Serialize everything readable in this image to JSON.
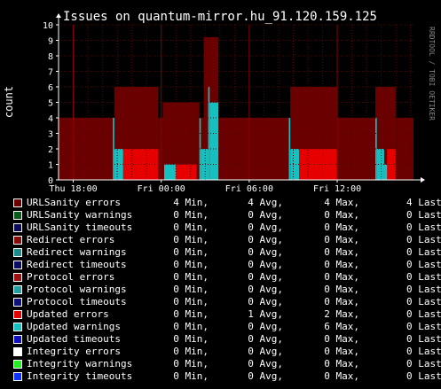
{
  "chart_data": {
    "type": "area",
    "title": "Issues on quantum-mirror.hu_91.120.159.125",
    "ylabel": "count",
    "watermark": "RRDTOOL / TOBI OETIKER",
    "ylim": [
      0,
      10
    ],
    "yticks": [
      0,
      1,
      2,
      3,
      4,
      5,
      6,
      7,
      8,
      9,
      10
    ],
    "xticks": [
      "Thu 18:00",
      "Fri 00:00",
      "Fri 06:00",
      "Fri 12:00"
    ],
    "xlim_hours": [
      0,
      24.2
    ],
    "xtick_hours": [
      1,
      7,
      13,
      19
    ],
    "colors": {
      "urlsanity_errors": "#6b0000",
      "urlsanity_errors_bright": "#7a0606",
      "updated_errors": "#e60000",
      "updated_warnings": "#15c0c0",
      "grid": "#5a0000"
    },
    "series": [
      {
        "name": "URLSanity errors",
        "color": "#6b0000",
        "segments": [
          [
            0,
            3.6,
            4
          ],
          [
            3.6,
            3.8,
            4
          ],
          [
            3.8,
            6.8,
            6
          ],
          [
            6.8,
            7.1,
            4
          ],
          [
            7.1,
            9.6,
            5
          ],
          [
            9.6,
            9.9,
            4
          ],
          [
            9.9,
            10.9,
            9.2
          ],
          [
            10.9,
            15.6,
            4
          ],
          [
            15.6,
            15.8,
            4
          ],
          [
            15.8,
            19.0,
            6
          ],
          [
            19.0,
            21.6,
            4
          ],
          [
            21.6,
            23.0,
            6
          ],
          [
            23.0,
            24.2,
            4
          ]
        ]
      },
      {
        "name": "Updated errors",
        "color": "#e60000",
        "segments": [
          [
            4.4,
            6.8,
            2
          ],
          [
            8.0,
            9.4,
            1
          ],
          [
            16.4,
            19.0,
            2
          ],
          [
            22.4,
            23.0,
            2
          ]
        ]
      },
      {
        "name": "Updated warnings",
        "color": "#15c0c0",
        "segments": [
          [
            3.7,
            3.8,
            4
          ],
          [
            3.8,
            4.4,
            2
          ],
          [
            7.2,
            8.0,
            1
          ],
          [
            9.6,
            9.7,
            4
          ],
          [
            9.7,
            10.2,
            2
          ],
          [
            10.2,
            10.3,
            6
          ],
          [
            10.3,
            10.9,
            5
          ],
          [
            15.7,
            15.8,
            4
          ],
          [
            15.8,
            16.4,
            2
          ],
          [
            21.6,
            21.7,
            4
          ],
          [
            21.7,
            22.2,
            2
          ],
          [
            22.2,
            22.4,
            1
          ]
        ]
      }
    ],
    "legend": [
      {
        "name": "URLSanity errors",
        "color": "#6b0000",
        "min": "4",
        "avg": "4",
        "max": "4",
        "last": "Last"
      },
      {
        "name": "URLSanity warnings",
        "color": "#0b5a1a",
        "min": "0",
        "avg": "0",
        "max": "0",
        "last": "Last"
      },
      {
        "name": "URLSanity timeouts",
        "color": "#0b0b5a",
        "min": "0",
        "avg": "0",
        "max": "0",
        "last": "Last"
      },
      {
        "name": "Redirect errors",
        "color": "#8a0a0a",
        "min": "0",
        "avg": "0",
        "max": "0",
        "last": "Last"
      },
      {
        "name": "Redirect warnings",
        "color": "#1a8a8a",
        "min": "0",
        "avg": "0",
        "max": "0",
        "last": "Last"
      },
      {
        "name": "Redirect timeouts",
        "color": "#0b0b6a",
        "min": "0",
        "avg": "0",
        "max": "0",
        "last": "Last"
      },
      {
        "name": "Protocol errors",
        "color": "#a01010",
        "min": "0",
        "avg": "0",
        "max": "0",
        "last": "Last"
      },
      {
        "name": "Protocol warnings",
        "color": "#20a0a0",
        "min": "0",
        "avg": "0",
        "max": "0",
        "last": "Last"
      },
      {
        "name": "Protocol timeouts",
        "color": "#10107a",
        "min": "0",
        "avg": "0",
        "max": "0",
        "last": "Last"
      },
      {
        "name": "Updated errors",
        "color": "#e60000",
        "min": "0",
        "avg": "1",
        "max": "2",
        "last": "Last"
      },
      {
        "name": "Updated warnings",
        "color": "#15c0c0",
        "min": "0",
        "avg": "0",
        "max": "6",
        "last": "Last"
      },
      {
        "name": "Updated timeouts",
        "color": "#1010c0",
        "min": "0",
        "avg": "0",
        "max": "0",
        "last": "Last"
      },
      {
        "name": "Integrity errors",
        "color": "#ffffff",
        "min": "0",
        "avg": "0",
        "max": "0",
        "last": "Last"
      },
      {
        "name": "Integrity warnings",
        "color": "#22ee22",
        "min": "0",
        "avg": "0",
        "max": "0",
        "last": "Last"
      },
      {
        "name": "Integrity timeouts",
        "color": "#1030ff",
        "min": "0",
        "avg": "0",
        "max": "0",
        "last": "Last"
      }
    ],
    "legend_suffixes": {
      "min": "Min,",
      "avg": "Avg,",
      "max": "Max,"
    }
  }
}
